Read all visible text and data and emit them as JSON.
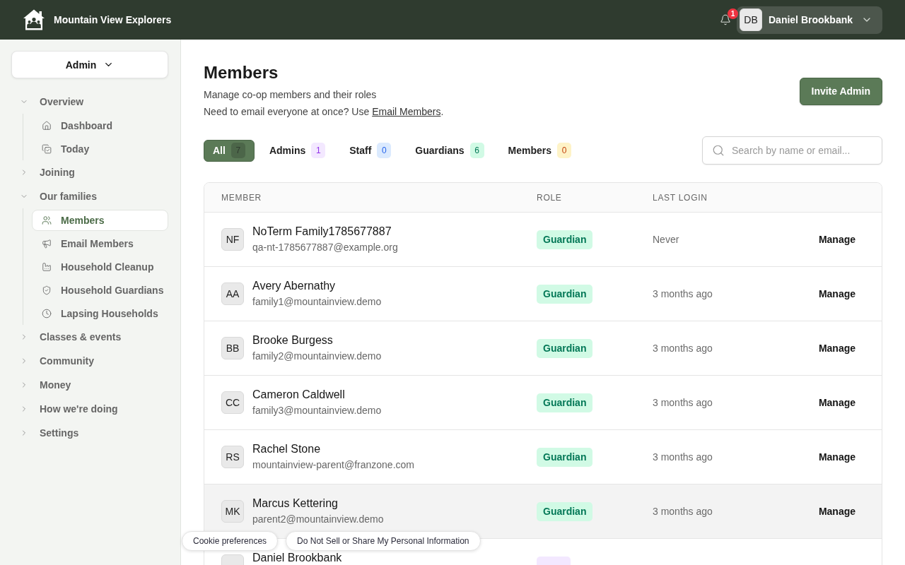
{
  "app": {
    "name": "Mountain View Explorers"
  },
  "topbar": {
    "notifications": "1",
    "user": {
      "initials": "DB",
      "name": "Daniel Brookbank"
    }
  },
  "sidebar": {
    "role_switcher": "Admin",
    "nav": [
      {
        "label": "Overview",
        "expanded": true,
        "children": [
          {
            "label": "Dashboard",
            "selected": false
          },
          {
            "label": "Today",
            "selected": false
          }
        ]
      },
      {
        "label": "Joining",
        "expanded": false
      },
      {
        "label": "Our families",
        "expanded": true,
        "children": [
          {
            "label": "Members",
            "selected": true
          },
          {
            "label": "Email Members",
            "selected": false
          },
          {
            "label": "Household Cleanup",
            "selected": false
          },
          {
            "label": "Household Guardians",
            "selected": false
          },
          {
            "label": "Lapsing Households",
            "selected": false
          }
        ]
      },
      {
        "label": "Classes & events",
        "expanded": false
      },
      {
        "label": "Community",
        "expanded": false
      },
      {
        "label": "Money",
        "expanded": false
      },
      {
        "label": "How we're doing",
        "expanded": false
      },
      {
        "label": "Settings",
        "expanded": false
      }
    ]
  },
  "page": {
    "title": "Members",
    "subtitle": "Manage co-op members and their roles",
    "note": {
      "text": "Need to email everyone at once? Use ",
      "link": "Email Members",
      "after": "."
    },
    "action": "Invite Admin"
  },
  "filters": {
    "tabs": [
      {
        "label": "All",
        "count": "7",
        "kind": "all",
        "selected": true
      },
      {
        "label": "Admins",
        "count": "1",
        "kind": "admin",
        "selected": false
      },
      {
        "label": "Staff",
        "count": "0",
        "kind": "staff",
        "selected": false
      },
      {
        "label": "Guardians",
        "count": "6",
        "kind": "guardian",
        "selected": false
      },
      {
        "label": "Members",
        "count": "0",
        "kind": "member",
        "selected": false
      }
    ],
    "search": {
      "placeholder": "Search by name or email..."
    }
  },
  "table": {
    "columns": [
      "MEMBER",
      "ROLE",
      "LAST LOGIN"
    ],
    "rows": [
      {
        "initials": "NF",
        "name": "NoTerm Family1785677887",
        "email": "qa-nt-1785677887@example.org",
        "role": {
          "label": "Guardian",
          "kind": "guardian"
        },
        "last_login": "Never",
        "action": "Manage",
        "hovered": false
      },
      {
        "initials": "AA",
        "name": "Avery Abernathy",
        "email": "family1@mountainview.demo",
        "role": {
          "label": "Guardian",
          "kind": "guardian"
        },
        "last_login": "3 months ago",
        "action": "Manage",
        "hovered": false
      },
      {
        "initials": "BB",
        "name": "Brooke Burgess",
        "email": "family2@mountainview.demo",
        "role": {
          "label": "Guardian",
          "kind": "guardian"
        },
        "last_login": "3 months ago",
        "action": "Manage",
        "hovered": false
      },
      {
        "initials": "CC",
        "name": "Cameron Caldwell",
        "email": "family3@mountainview.demo",
        "role": {
          "label": "Guardian",
          "kind": "guardian"
        },
        "last_login": "3 months ago",
        "action": "Manage",
        "hovered": false
      },
      {
        "initials": "RS",
        "name": "Rachel Stone",
        "email": "mountainview-parent@franzone.com",
        "role": {
          "label": "Guardian",
          "kind": "guardian"
        },
        "last_login": "3 months ago",
        "action": "Manage",
        "hovered": false
      },
      {
        "initials": "MK",
        "name": "Marcus Kettering",
        "email": "parent2@mountainview.demo",
        "role": {
          "label": "Guardian",
          "kind": "guardian"
        },
        "last_login": "3 months ago",
        "action": "Manage",
        "hovered": true
      },
      {
        "name": "Daniel Brookbank",
        "role": {
          "kind": "admin"
        },
        "hovered": false
      }
    ]
  },
  "cookie_bar": {
    "buttons": [
      "Cookie preferences",
      "Do Not Sell or Share My Personal Information"
    ]
  }
}
